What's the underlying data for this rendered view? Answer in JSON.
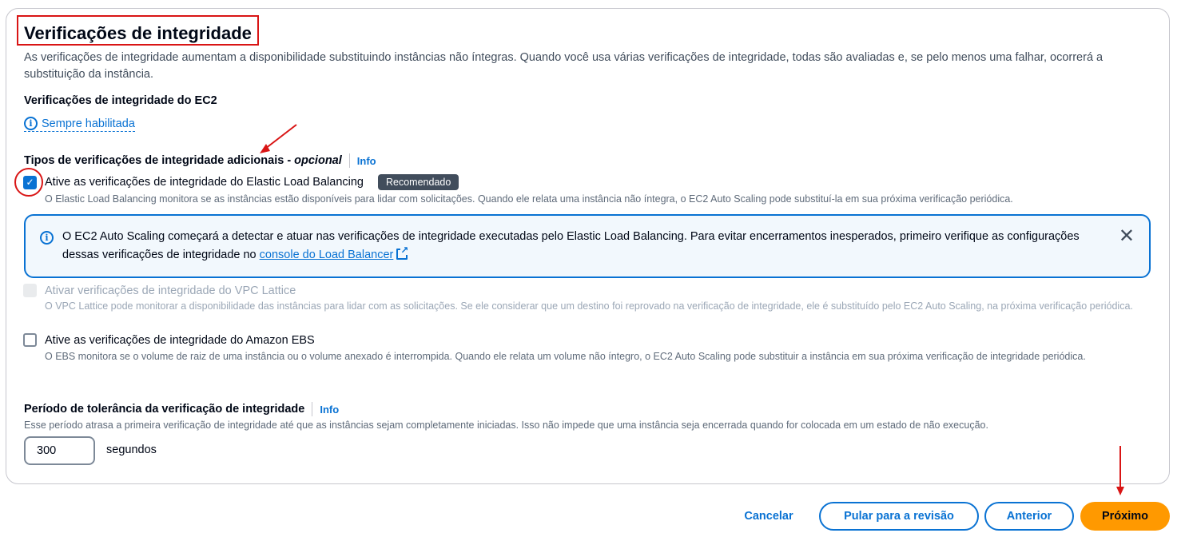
{
  "section": {
    "title": "Verificações de integridade",
    "description": "As verificações de integridade aumentam a disponibilidade substituindo instâncias não íntegras. Quando você usa várias verificações de integridade, todas são avaliadas e, se pelo menos uma falhar, ocorrerá a substituição da instância."
  },
  "ec2": {
    "title": "Verificações de integridade do EC2",
    "status": "Sempre habilitada"
  },
  "additional": {
    "title": "Tipos de verificações de integridade adicionais -",
    "optional": "opcional",
    "info": "Info",
    "elb": {
      "label": "Ative as verificações de integridade do Elastic Load Balancing",
      "checked": true,
      "badge": "Recomendado",
      "help": "O Elastic Load Balancing monitora se as instâncias estão disponíveis para lidar com solicitações. Quando ele relata uma instância não íntegra, o EC2 Auto Scaling pode substituí-la em sua próxima verificação periódica."
    },
    "alert": {
      "text": "O EC2 Auto Scaling começará a detectar e atuar nas verificações de integridade executadas pelo Elastic Load Balancing. Para evitar encerramentos inesperados, primeiro verifique as configurações dessas verificações de integridade no",
      "link": "console do Load Balancer"
    },
    "vpc": {
      "label": "Ativar verificações de integridade do VPC Lattice",
      "checked": false,
      "disabled": true,
      "help": "O VPC Lattice pode monitorar a disponibilidade das instâncias para lidar com as solicitações. Se ele considerar que um destino foi reprovado na verificação de integridade, ele é substituído pelo EC2 Auto Scaling, na próxima verificação periódica."
    },
    "ebs": {
      "label": "Ative as verificações de integridade do Amazon EBS",
      "checked": false,
      "help": "O EBS monitora se o volume de raiz de uma instância ou o volume anexado é interrompida. Quando ele relata um volume não íntegro, o EC2 Auto Scaling pode substituir a instância em sua próxima verificação de integridade periódica."
    }
  },
  "grace": {
    "title": "Período de tolerância da verificação de integridade",
    "info": "Info",
    "help": "Esse período atrasa a primeira verificação de integridade até que as instâncias sejam completamente iniciadas. Isso não impede que uma instância seja encerrada quando for colocada em um estado de não execução.",
    "value": "300",
    "units": "segundos"
  },
  "footer": {
    "cancel": "Cancelar",
    "skip": "Pular para a revisão",
    "previous": "Anterior",
    "next": "Próximo"
  },
  "colors": {
    "accent": "#0972d3",
    "primary_button": "#ff9900",
    "annotation": "#d91515"
  }
}
